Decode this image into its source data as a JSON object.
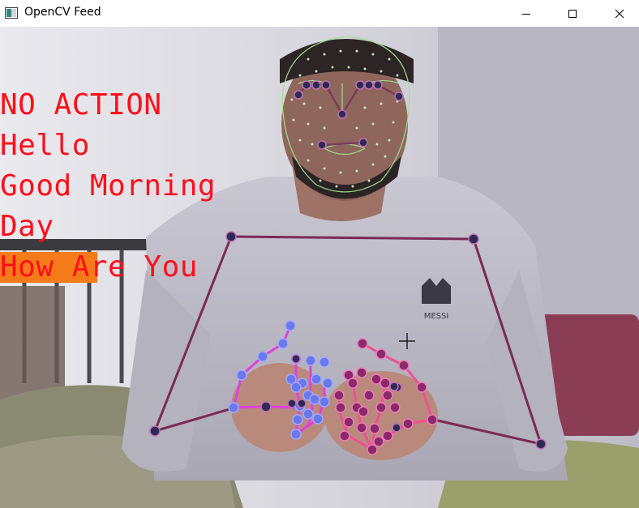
{
  "window": {
    "title": "OpenCV Feed",
    "controls": {
      "minimize": "minimize-icon",
      "maximize": "maximize-icon",
      "close": "close-icon"
    }
  },
  "feed": {
    "actions": [
      "NO ACTION",
      "Hello",
      "Good Morning",
      "Day",
      "How Are You"
    ],
    "active_action": "How Are You",
    "text_color": "#ff0f1a",
    "highlight_color": "#f57a1a",
    "shirt_logo": "MESSI"
  }
}
